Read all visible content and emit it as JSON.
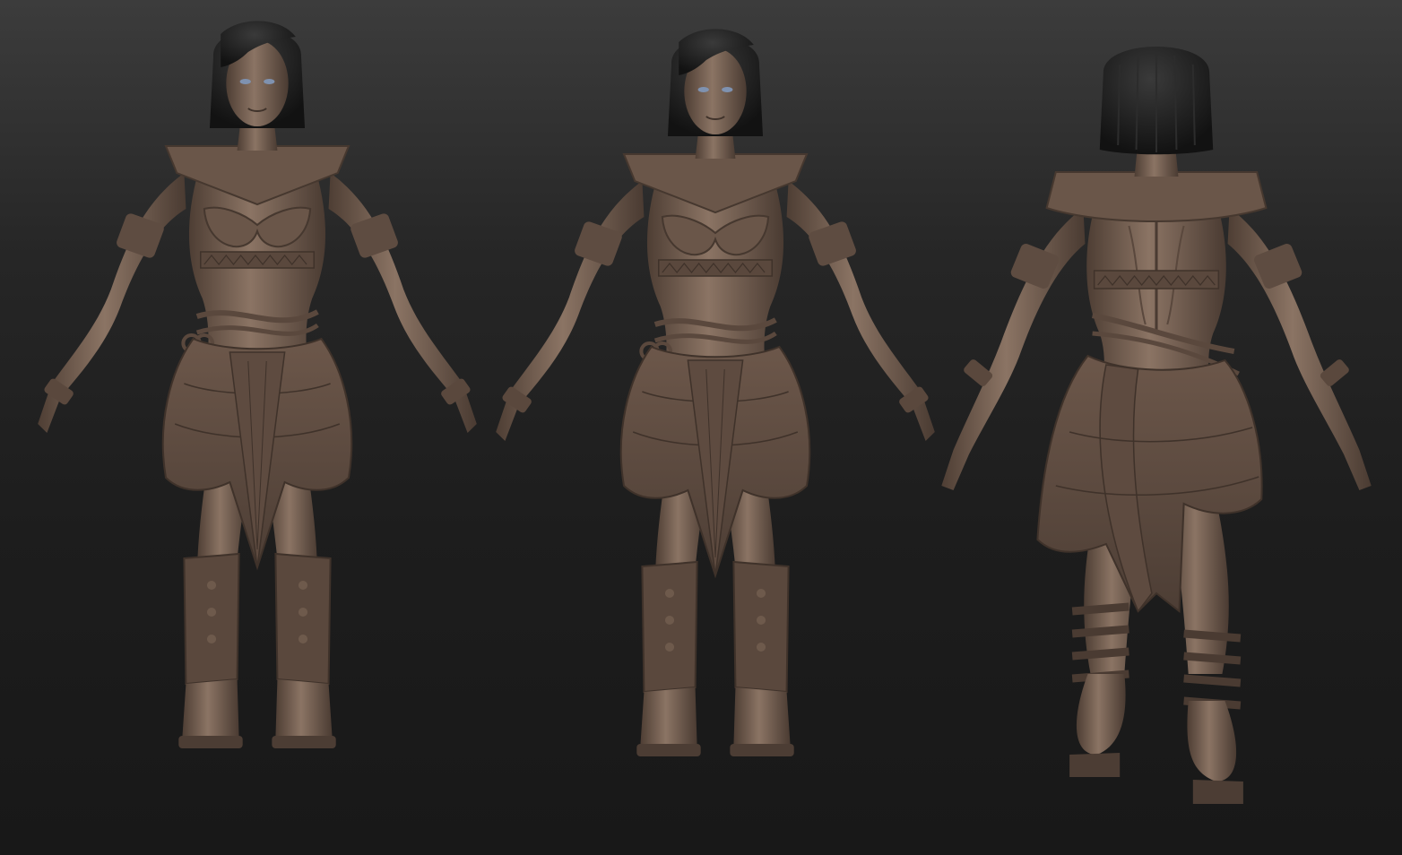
{
  "scene": {
    "background_top": "#3c3c3c",
    "background_bottom": "#181818",
    "clay": "#6f5a4d",
    "clay_light": "#97806f",
    "clay_dark": "#4a3b32",
    "hair": "#1b1b1b",
    "eyes": "#7f92b0"
  },
  "views": [
    {
      "id": "front-three-quarter",
      "eyes_visible": true
    },
    {
      "id": "front",
      "eyes_visible": true
    },
    {
      "id": "back",
      "eyes_visible": false
    }
  ]
}
